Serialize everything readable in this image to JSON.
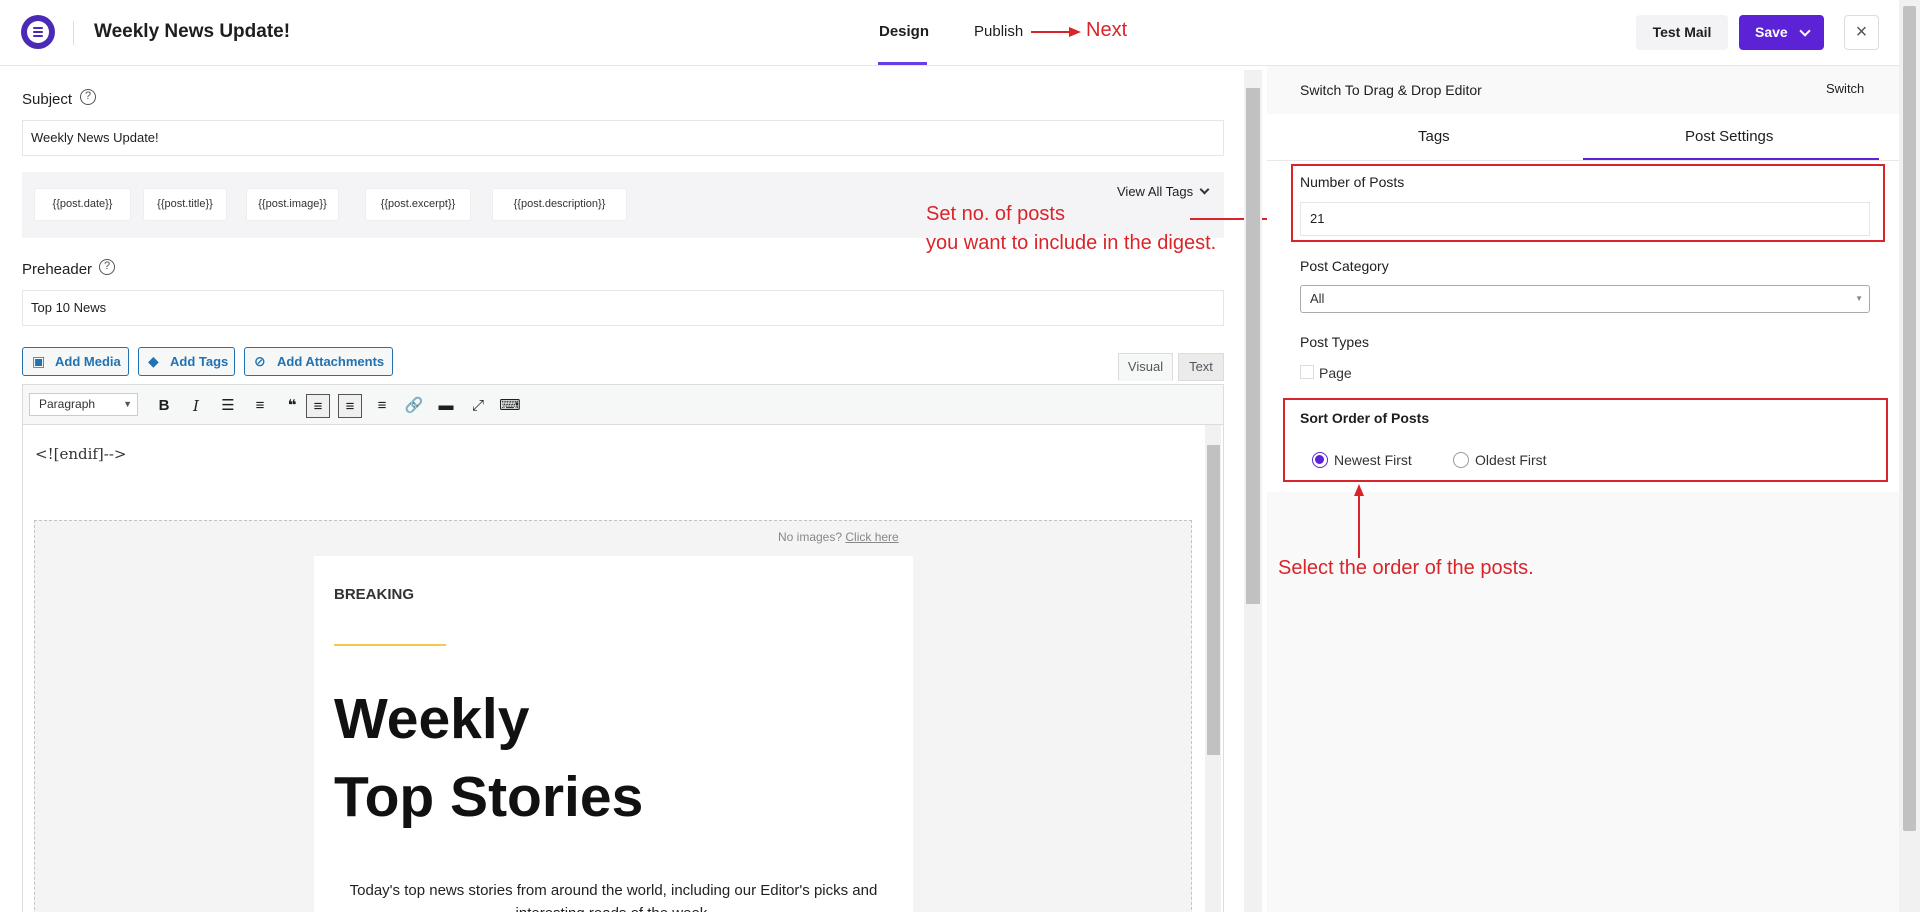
{
  "header": {
    "title": "Weekly News Update!",
    "tabs": [
      "Design",
      "Publish"
    ],
    "test_mail": "Test Mail",
    "save": "Save",
    "close": "×"
  },
  "editor": {
    "subject_label": "Subject",
    "subject_value": "Weekly News Update!",
    "tags": [
      "{{post.date}}",
      "{{post.title}}",
      "{{post.image}}",
      "{{post.excerpt}}",
      "{{post.description}}"
    ],
    "view_all_tags": "View All Tags",
    "preheader_label": "Preheader",
    "preheader_value": "Top 10 News",
    "media_buttons": {
      "add_media": "Add Media",
      "add_tags": "Add Tags",
      "add_attachments": "Add Attachments"
    },
    "view_tabs": {
      "visual": "Visual",
      "text": "Text"
    },
    "format_select": "Paragraph",
    "code_line": "<![endif]-->",
    "no_images": "No images?",
    "click_here": "Click here",
    "email": {
      "kicker": "BREAKING",
      "headline_1": "Weekly",
      "headline_2": "Top Stories",
      "intro": "Today's top news stories from around the world, including our Editor's picks and interesting reads of the week."
    }
  },
  "panel": {
    "switch_label": "Switch To Drag & Drop Editor",
    "switch_button": "Switch",
    "tabs": [
      "Tags",
      "Post Settings"
    ],
    "active_tab": "Post Settings",
    "number_of_posts_label": "Number of Posts",
    "number_of_posts_value": "21",
    "post_category_label": "Post Category",
    "post_category_value": "All",
    "post_types_label": "Post Types",
    "post_type_option": "Page",
    "sort_order_label": "Sort Order of Posts",
    "sort_options": [
      "Newest First",
      "Oldest First"
    ],
    "sort_selected": "Newest First"
  },
  "annotations": {
    "next": "Next",
    "posts_note_1": "Set no. of posts",
    "posts_note_2": "you want to include in the digest.",
    "order_note": "Select the order of the posts."
  },
  "colors": {
    "accent": "#5b22d6",
    "annotation": "#d9242a",
    "link": "#2271b1"
  }
}
